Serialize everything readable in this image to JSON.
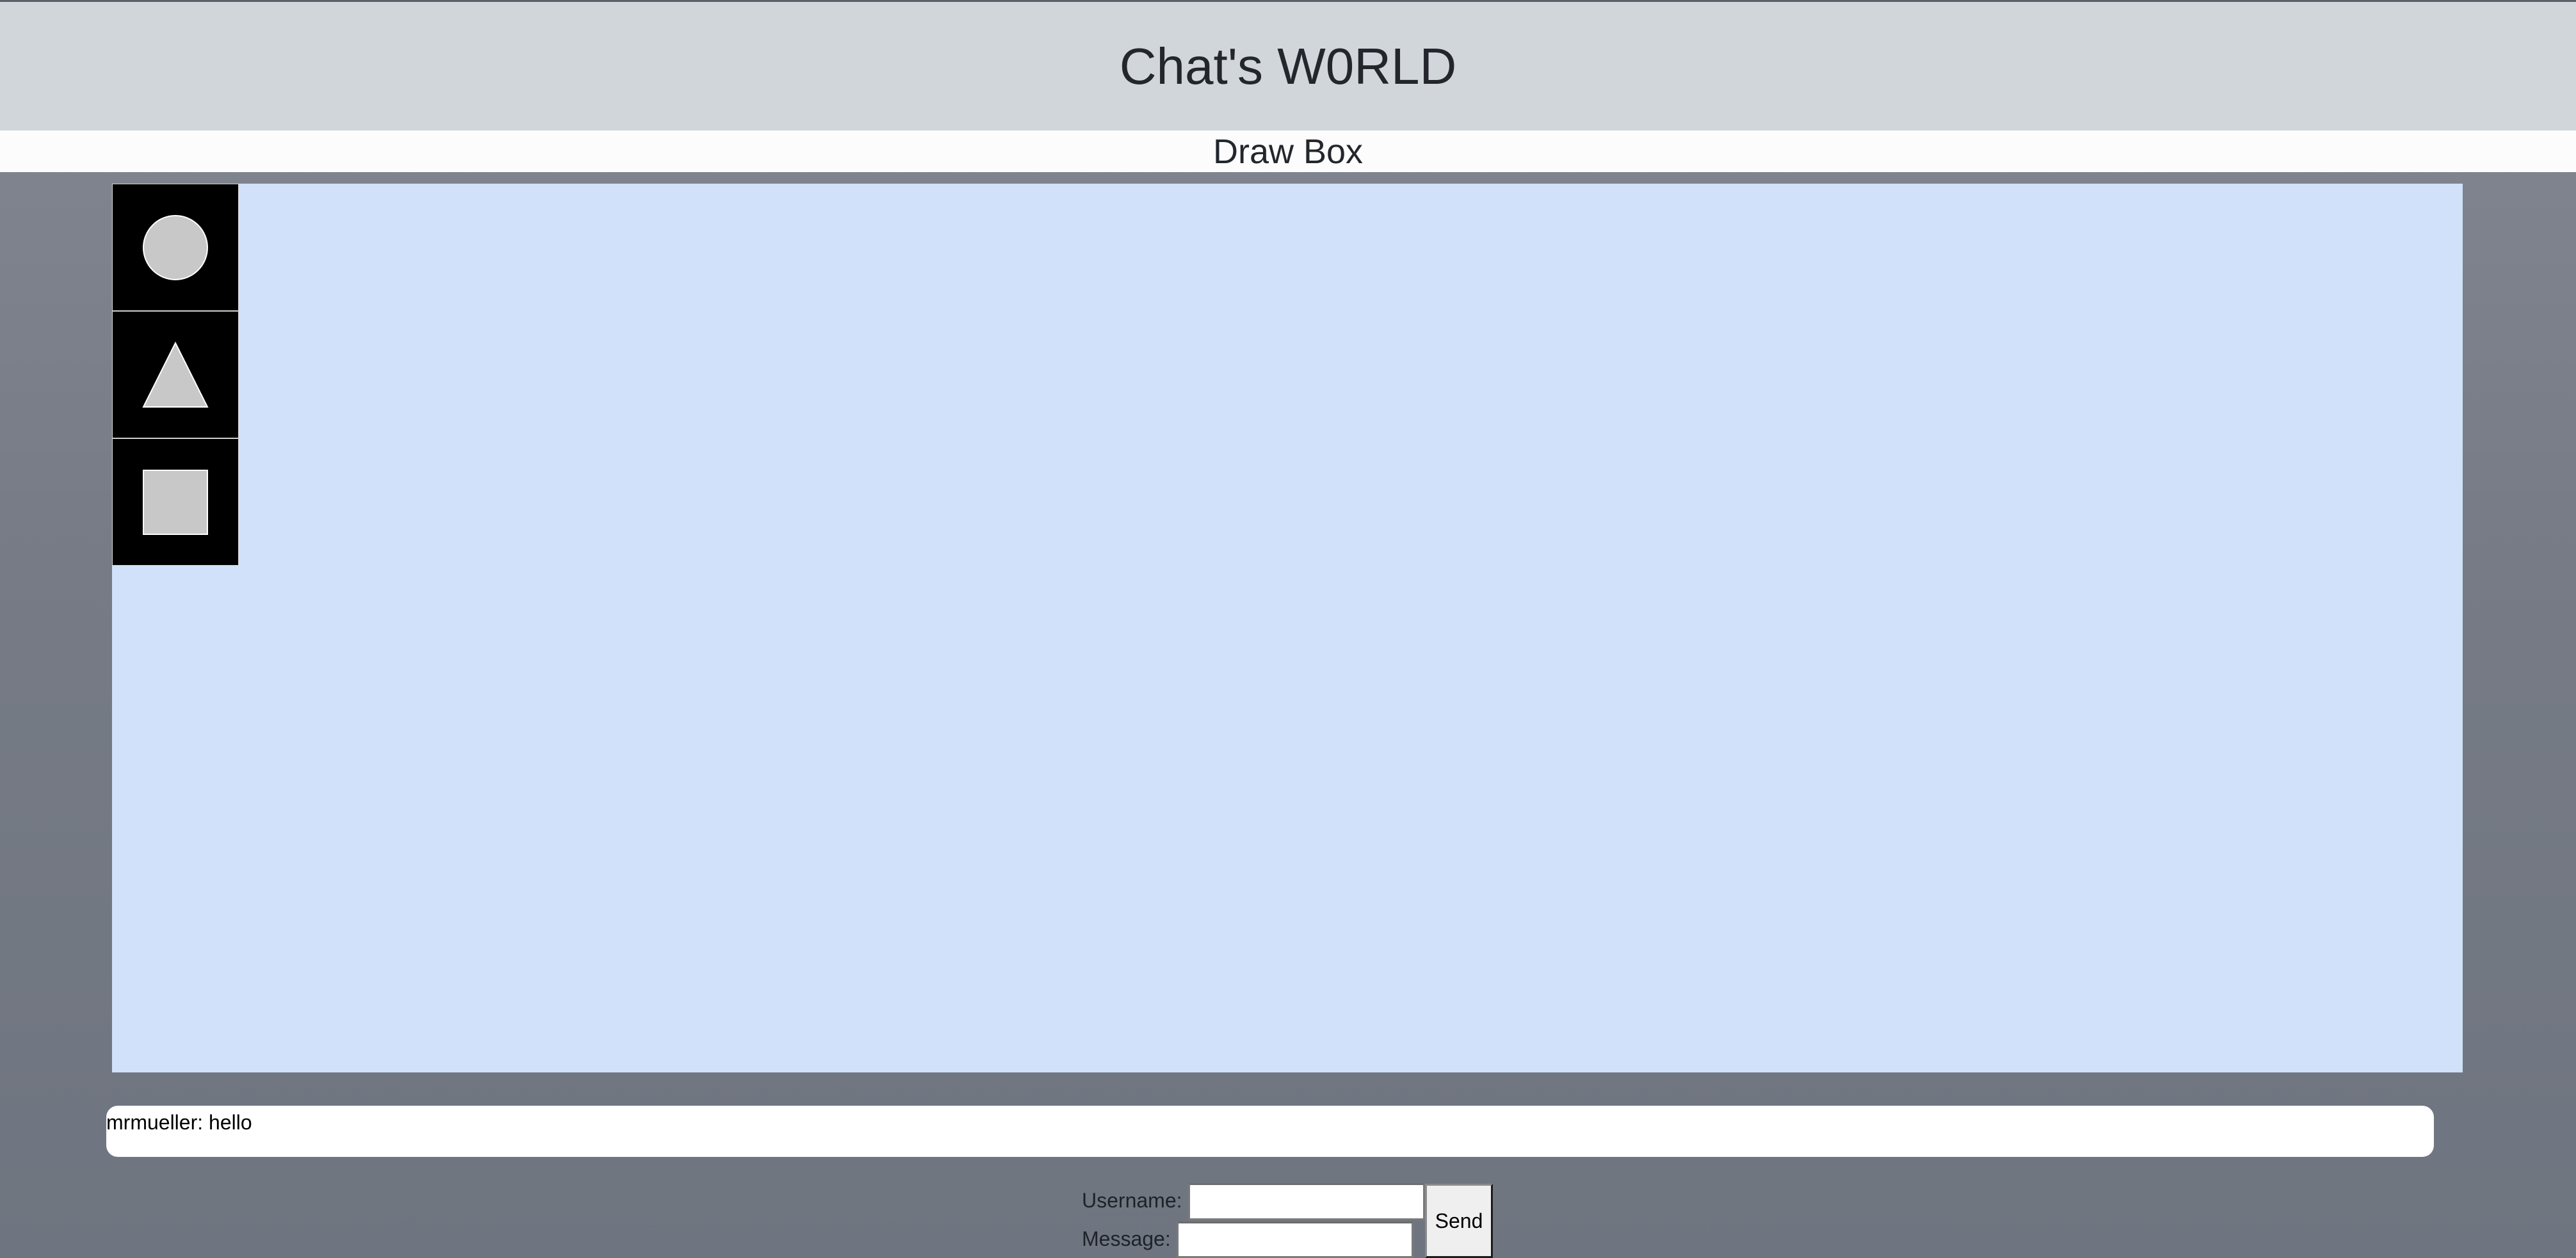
{
  "header": {
    "title": "Chat's W0RLD"
  },
  "draw_box": {
    "title": "Draw Box",
    "tools": [
      {
        "icon": "circle-icon"
      },
      {
        "icon": "triangle-icon"
      },
      {
        "icon": "square-icon"
      }
    ]
  },
  "chat": {
    "messages": [
      {
        "text": "mrmueller: hello"
      }
    ]
  },
  "form": {
    "username_label": "Username:",
    "username_value": "",
    "message_label": "Message:",
    "message_value": "",
    "send_label": "Send"
  },
  "colors": {
    "header_bg": "#d1d6db",
    "canvas_bg": "#d1e1f9",
    "tool_bg": "#000000",
    "shape_fill": "#c8c8c8"
  }
}
